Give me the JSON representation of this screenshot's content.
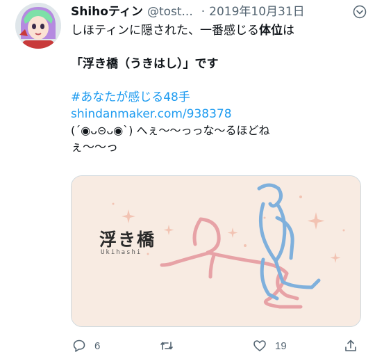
{
  "tweet": {
    "author_name": "Shihoティン",
    "handle": "@tost...",
    "separator": "·",
    "date": "2019年10月31日",
    "text": {
      "line1_pre": "しほティンに隠された、一番感じる",
      "line1_bold": "体位",
      "line1_post": "は",
      "line2_pre": "「",
      "line2_bold": "浮き橋",
      "line2_post": "（うきはし）」です",
      "hashtag": "#あなたが感じる48手",
      "url": "shindanmaker.com/938378",
      "line5": "(´◉ᴗ⊝ᴗ◉`) へぇ〜〜っっな〜るほどね",
      "line6": "ぇ〜〜っ"
    },
    "card": {
      "title": "浮き橋",
      "subtitle": "Ukihashi"
    },
    "actions": {
      "reply_count": "6",
      "retweet_count": "",
      "like_count": "19"
    }
  },
  "colors": {
    "link": "#1d9bf0",
    "muted": "#536471",
    "card_bg": "#f8ebe2",
    "figure_pink": "#e7a2a6",
    "figure_blue": "#7fb0dc"
  }
}
